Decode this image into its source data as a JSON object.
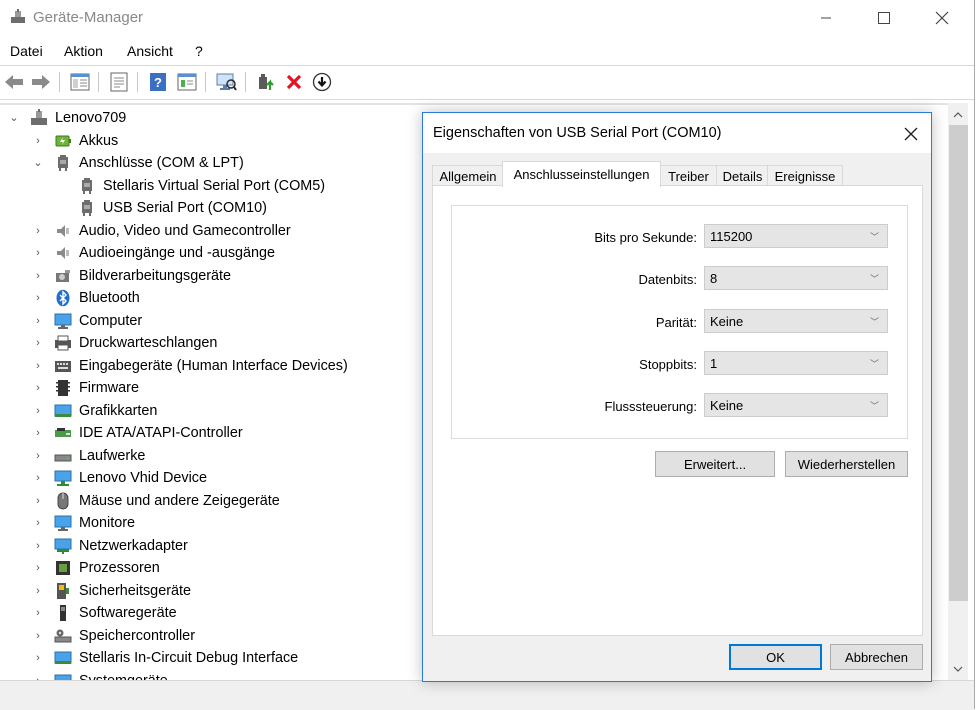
{
  "window": {
    "title": "Geräte-Manager"
  },
  "menu": [
    "Datei",
    "Aktion",
    "Ansicht",
    "?"
  ],
  "tree": {
    "root": "Lenovo709",
    "items": [
      {
        "label": "Akkus",
        "icon": "battery-icon",
        "expanded": false,
        "level": 1
      },
      {
        "label": "Anschlüsse (COM & LPT)",
        "icon": "port-icon",
        "expanded": true,
        "level": 1
      },
      {
        "label": "Stellaris Virtual Serial Port (COM5)",
        "icon": "port-icon",
        "level": 2
      },
      {
        "label": "USB Serial Port (COM10)",
        "icon": "port-icon",
        "level": 2
      },
      {
        "label": "Audio, Video und Gamecontroller",
        "icon": "speaker-icon",
        "expanded": false,
        "level": 1
      },
      {
        "label": "Audioeingänge und -ausgänge",
        "icon": "speaker-icon",
        "expanded": false,
        "level": 1
      },
      {
        "label": "Bildverarbeitungsgeräte",
        "icon": "camera-icon",
        "expanded": false,
        "level": 1
      },
      {
        "label": "Bluetooth",
        "icon": "bluetooth-icon",
        "expanded": false,
        "level": 1
      },
      {
        "label": "Computer",
        "icon": "computer-icon",
        "expanded": false,
        "level": 1
      },
      {
        "label": "Druckwarteschlangen",
        "icon": "printer-icon",
        "expanded": false,
        "level": 1
      },
      {
        "label": "Eingabegeräte (Human Interface Devices)",
        "icon": "keyboard-icon",
        "expanded": false,
        "level": 1
      },
      {
        "label": "Firmware",
        "icon": "firmware-icon",
        "expanded": false,
        "level": 1
      },
      {
        "label": "Grafikkarten",
        "icon": "display-adapter-icon",
        "expanded": false,
        "level": 1
      },
      {
        "label": "IDE ATA/ATAPI-Controller",
        "icon": "ide-controller-icon",
        "expanded": false,
        "level": 1
      },
      {
        "label": "Laufwerke",
        "icon": "drive-icon",
        "expanded": false,
        "level": 1
      },
      {
        "label": "Lenovo Vhid Device",
        "icon": "network-device-icon",
        "expanded": false,
        "level": 1
      },
      {
        "label": "Mäuse und andere Zeigegeräte",
        "icon": "mouse-icon",
        "expanded": false,
        "level": 1
      },
      {
        "label": "Monitore",
        "icon": "monitor-icon",
        "expanded": false,
        "level": 1
      },
      {
        "label": "Netzwerkadapter",
        "icon": "network-adapter-icon",
        "expanded": false,
        "level": 1
      },
      {
        "label": "Prozessoren",
        "icon": "processor-icon",
        "expanded": false,
        "level": 1
      },
      {
        "label": "Sicherheitsgeräte",
        "icon": "security-device-icon",
        "expanded": false,
        "level": 1
      },
      {
        "label": "Softwaregeräte",
        "icon": "software-device-icon",
        "expanded": false,
        "level": 1
      },
      {
        "label": "Speichercontroller",
        "icon": "storage-controller-icon",
        "expanded": false,
        "level": 1
      },
      {
        "label": "Stellaris In-Circuit Debug Interface",
        "icon": "debug-interface-icon",
        "expanded": false,
        "level": 1
      },
      {
        "label": "Systemgeräte",
        "icon": "system-device-icon",
        "expanded": false,
        "level": 1
      }
    ]
  },
  "dialog": {
    "title": "Eigenschaften von USB Serial Port (COM10)",
    "tabs": [
      "Allgemein",
      "Anschlusseinstellungen",
      "Treiber",
      "Details",
      "Ereignisse"
    ],
    "active_tab": "Anschlusseinstellungen",
    "fields": [
      {
        "label": "Bits pro Sekunde:",
        "value": "115200"
      },
      {
        "label": "Datenbits:",
        "value": "8"
      },
      {
        "label": "Parität:",
        "value": "Keine"
      },
      {
        "label": "Stoppbits:",
        "value": "1"
      },
      {
        "label": "Flusssteuerung:",
        "value": "Keine"
      }
    ],
    "buttons": {
      "advanced": "Erweitert...",
      "restore": "Wiederherstellen",
      "ok": "OK",
      "cancel": "Abbrechen"
    }
  },
  "colors": {
    "accent": "#0078d7",
    "dialog_border": "#2b79d8",
    "delete_red": "#e81123"
  }
}
